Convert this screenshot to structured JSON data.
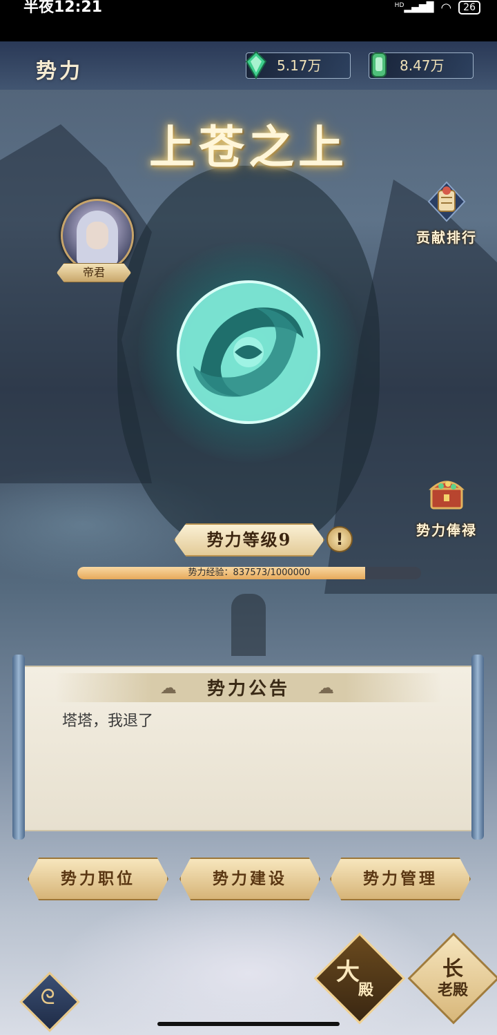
{
  "status_bar": {
    "time": "半夜12:21",
    "network": "HD",
    "battery": "26"
  },
  "header": {
    "title": "势力",
    "resources": [
      {
        "icon": "green-gem-icon",
        "value": "5.17万"
      },
      {
        "icon": "jade-token-icon",
        "value": "8.47万"
      }
    ]
  },
  "faction": {
    "name": "上苍之上"
  },
  "leader": {
    "title": "帝君"
  },
  "side_buttons": {
    "ranking": "贡献排行",
    "salary": "势力俸禄"
  },
  "level": {
    "label": "势力等级9",
    "exp_text": "势力经验：837573/1000000",
    "exp_current": 837573,
    "exp_max": 1000000
  },
  "notice": {
    "title": "势力公告",
    "content": "塔塔，我退了"
  },
  "actions": {
    "position": "势力职位",
    "build": "势力建设",
    "manage": "势力管理"
  },
  "nav": {
    "main_hall_top": "大",
    "main_hall_bottom": "殿",
    "elder_hall_top": "长",
    "elder_hall_bottom": "老殿"
  },
  "colors": {
    "emblem": "#7de8d6",
    "gold": "#d6b478",
    "exp_fill": "#e6a95b"
  }
}
